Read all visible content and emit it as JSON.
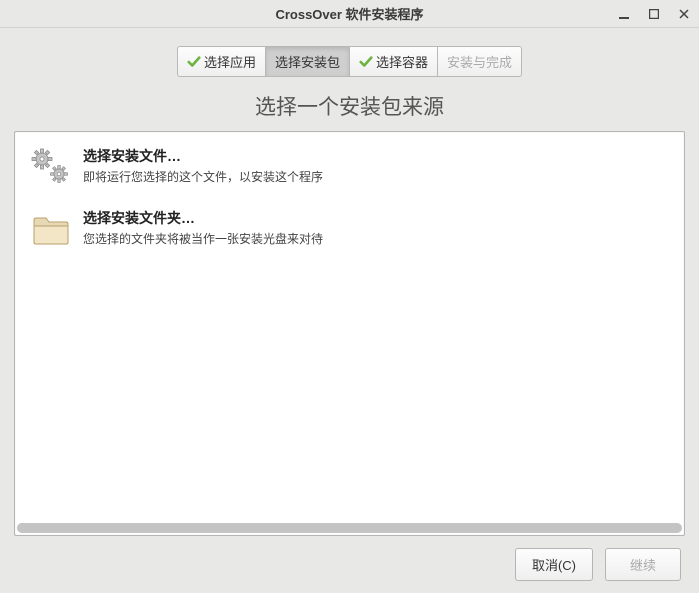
{
  "window": {
    "title": "CrossOver 软件安装程序"
  },
  "steps": {
    "select_app": "选择应用",
    "select_package": "选择安装包",
    "select_bottle": "选择容器",
    "install_finish": "安装与完成"
  },
  "heading": "选择一个安装包来源",
  "options": {
    "file": {
      "title": "选择安装文件…",
      "desc": "即将运行您选择的这个文件，以安装这个程序"
    },
    "folder": {
      "title": "选择安装文件夹…",
      "desc": "您选择的文件夹将被当作一张安装光盘来对待"
    }
  },
  "buttons": {
    "cancel": "取消(C)",
    "continue": "继续"
  }
}
